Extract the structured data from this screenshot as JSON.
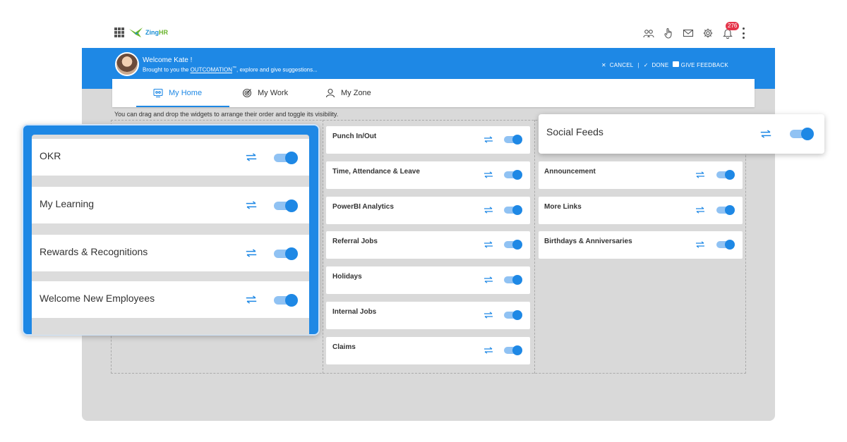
{
  "brand": {
    "logo_prefix": "Zing",
    "logo_suffix": "HR"
  },
  "topbar": {
    "icons": [
      "grid-icon",
      "people-icon",
      "hand-icon",
      "mail-icon",
      "gear-icon",
      "bell-icon",
      "kebab-icon"
    ],
    "notification_count": "276"
  },
  "header": {
    "welcome": "Welcome Kate !",
    "tagline_pre": "Brought to you the ",
    "tagline_link": "OUTCOMATION",
    "tagline_tm": "™",
    "tagline_post": ", explore and give suggestions...",
    "cancel": "CANCEL",
    "separator": "|",
    "done": "DONE",
    "feedback": "GIVE FEEDBACK"
  },
  "tabs": [
    {
      "label": "My Home",
      "icon": "home-widget-icon",
      "active": true
    },
    {
      "label": "My Work",
      "icon": "target-icon",
      "active": false
    },
    {
      "label": "My Zone",
      "icon": "user-icon",
      "active": false
    }
  ],
  "hint": "You can drag and drop the widgets to arrange their order and toggle its visibility.",
  "left_widgets": [
    "OKR",
    "My Learning",
    "Rewards & Recognitions",
    "Welcome New Employees"
  ],
  "middle_widgets": [
    "Punch In/Out",
    "Time, Attendance & Leave",
    "PowerBI Analytics",
    "Referral Jobs",
    "Holidays",
    "Internal Jobs",
    "Claims"
  ],
  "right_widgets": [
    "Social Feeds",
    "Announcement",
    "More Links",
    "Birthdays & Anniversaries"
  ],
  "colors": {
    "primary": "#1e88e5",
    "toggle_track": "#90c2f3",
    "badge": "#e5344a",
    "background": "#d9d9d9"
  }
}
